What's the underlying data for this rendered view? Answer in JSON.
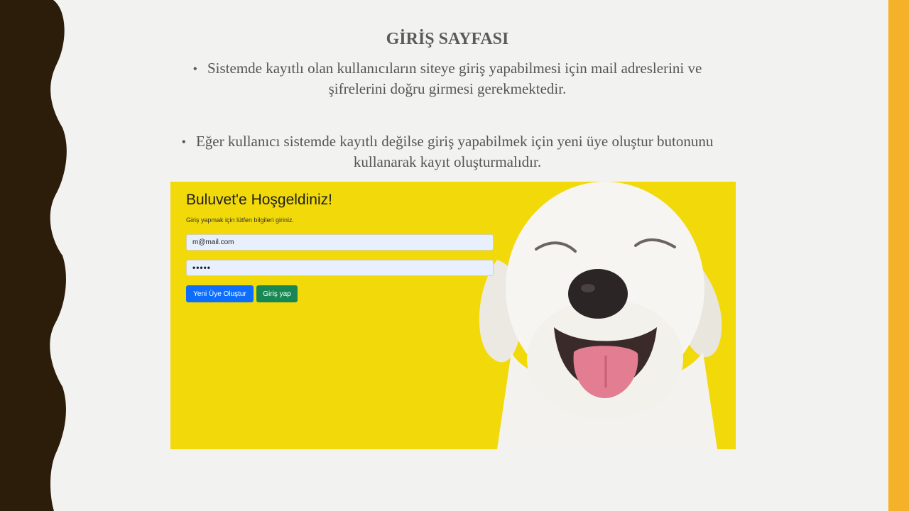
{
  "slide": {
    "title": "GİRİŞ SAYFASI",
    "bullets": [
      "Sistemde kayıtlı olan kullanıcıların siteye giriş yapabilmesi için mail adreslerini ve şifrelerini doğru girmesi gerekmektedir.",
      "Eğer kullanıcı sistemde kayıtlı değilse giriş yapabilmek için yeni üye oluştur butonunu kullanarak kayıt oluşturmalıdır."
    ]
  },
  "login": {
    "heading": "Buluvet'e Hoşgeldiniz!",
    "subtitle": "Giriş yapmak için lütfen bilgileri giriniz.",
    "email_value": "m@mail.com",
    "password_value": "•••••",
    "new_member_label": "Yeni Üye Oluştur",
    "login_label": "Giriş yap"
  },
  "colors": {
    "background": "#f1d90a",
    "primary_button": "#0d6efd",
    "success_button": "#198754",
    "accent_bar": "#f5b12a",
    "wave_border": "#2b1d0a"
  }
}
